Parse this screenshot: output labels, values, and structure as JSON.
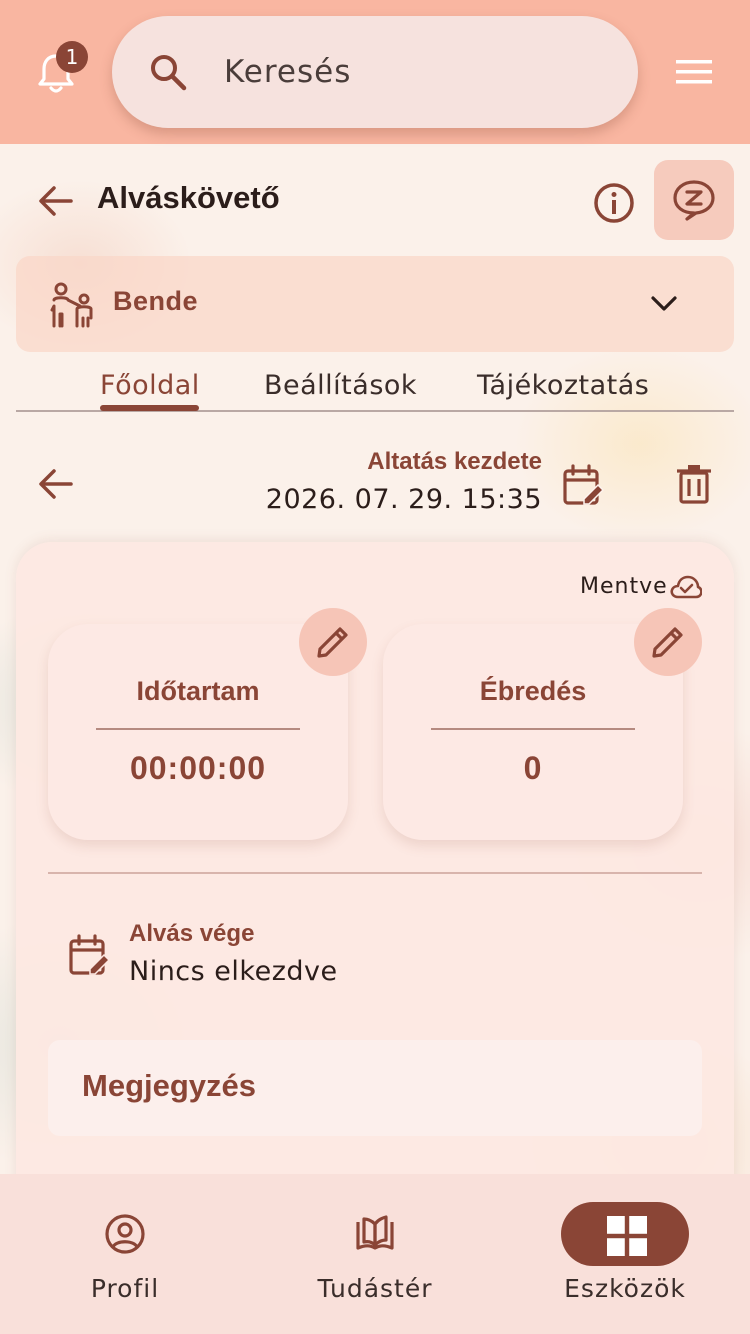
{
  "header": {
    "notification_count": "1",
    "search_placeholder": "Keresés"
  },
  "page": {
    "title": "Alváskövető"
  },
  "child": {
    "name": "Bende"
  },
  "tabs": [
    {
      "label": "Főoldal",
      "active": true
    },
    {
      "label": "Beállítások",
      "active": false
    },
    {
      "label": "Tájékoztatás",
      "active": false
    }
  ],
  "session": {
    "start_label": "Altatás kezdete",
    "start_value": "2026. 07. 29. 15:35",
    "saved_label": "Mentve",
    "duration_title": "Időtartam",
    "duration_value": "00:00:00",
    "wakeups_title": "Ébredés",
    "wakeups_value": "0",
    "end_label": "Alvás vége",
    "end_value": "Nincs elkezdve",
    "note_title": "Megjegyzés"
  },
  "bottom_nav": [
    {
      "label": "Profil",
      "icon": "profile-icon",
      "active": false
    },
    {
      "label": "Tudástér",
      "icon": "book-icon",
      "active": false
    },
    {
      "label": "Eszközök",
      "icon": "grid-icon",
      "active": true
    }
  ],
  "colors": {
    "accent": "#8a4536",
    "header_bg": "#f9b6a1",
    "nav_bg": "#f9e0da"
  }
}
